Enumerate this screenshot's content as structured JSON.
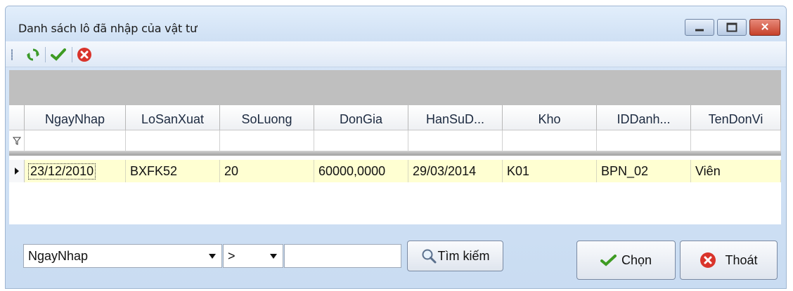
{
  "window": {
    "title": "Danh sách lô đã nhập của vật tư"
  },
  "window_controls": {
    "minimize_icon": "minimize-icon",
    "maximize_icon": "maximize-icon",
    "close_icon": "close-icon",
    "close_glyph": "✕"
  },
  "toolbar": {
    "items": [
      {
        "name": "refresh",
        "icon": "refresh-icon",
        "color": "#3c9a2a"
      },
      {
        "name": "select",
        "icon": "check-icon",
        "color": "#3e9b22"
      },
      {
        "name": "cancel",
        "icon": "cancel-icon",
        "color": "#d9342b"
      }
    ]
  },
  "grid": {
    "columns": [
      "NgayNhap",
      "LoSanXuat",
      "SoLuong",
      "DonGia",
      "HanSuD...",
      "Kho",
      "IDDanh...",
      "TenDonVi"
    ],
    "filter_icon": "filter-icon",
    "rows": [
      [
        "23/12/2010",
        "BXFK52",
        "20",
        "60000,0000",
        "29/03/2014",
        "K01",
        "BPN_02",
        "Viên"
      ]
    ],
    "selected_row_color": "#ffffd2"
  },
  "search": {
    "field_value": "NgayNhap",
    "operator_value": ">",
    "text_value": "",
    "button_label": "Tìm kiếm"
  },
  "actions": {
    "choose_label": "Chọn",
    "exit_label": "Thoát"
  }
}
